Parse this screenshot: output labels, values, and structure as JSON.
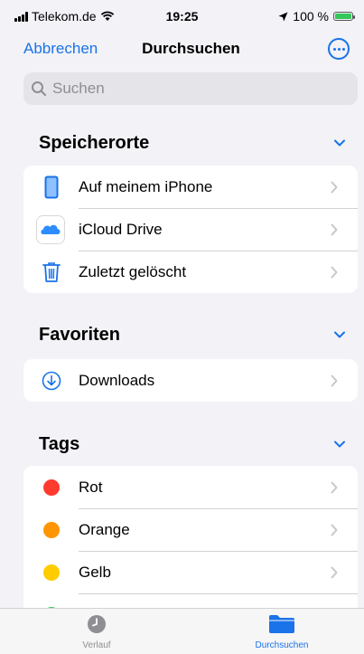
{
  "status_bar": {
    "carrier": "Telekom.de",
    "time": "19:25",
    "battery_text": "100 %"
  },
  "nav": {
    "cancel_label": "Abbrechen",
    "title": "Durchsuchen",
    "more_icon": "ellipsis-circle-icon"
  },
  "search": {
    "placeholder": "Suchen"
  },
  "sections": {
    "locations": {
      "title": "Speicherorte",
      "items": [
        {
          "label": "Auf meinem iPhone",
          "icon": "iphone-icon"
        },
        {
          "label": "iCloud Drive",
          "icon": "icloud-icon"
        },
        {
          "label": "Zuletzt gelöscht",
          "icon": "trash-icon"
        }
      ]
    },
    "favorites": {
      "title": "Favoriten",
      "items": [
        {
          "label": "Downloads",
          "icon": "download-circle-icon"
        }
      ]
    },
    "tags": {
      "title": "Tags",
      "items": [
        {
          "label": "Rot",
          "color": "#ff3b30"
        },
        {
          "label": "Orange",
          "color": "#ff9500"
        },
        {
          "label": "Gelb",
          "color": "#ffcc00"
        }
      ]
    }
  },
  "tabbar": {
    "tabs": [
      {
        "label": "Verlauf",
        "icon": "clock-icon",
        "selected": false
      },
      {
        "label": "Durchsuchen",
        "icon": "folder-icon",
        "selected": true
      }
    ]
  },
  "colors": {
    "accent": "#1a73e8",
    "background": "#f2f2f7"
  }
}
